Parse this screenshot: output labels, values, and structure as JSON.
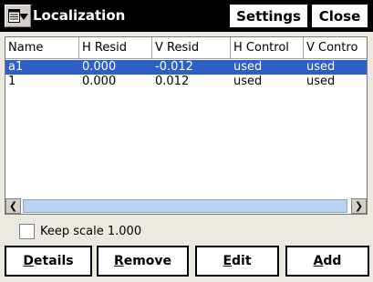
{
  "titlebar": {
    "title": "Localization",
    "settings_label": "Settings",
    "close_label": "Close",
    "menu_icon": "menu-icon"
  },
  "table": {
    "columns": [
      "Name",
      "H Resid",
      "V Resid",
      "H Control",
      "V Contro"
    ],
    "rows": [
      {
        "name": "a1",
        "h_resid": "0.000",
        "v_resid": "-0.012",
        "h_control": "used",
        "v_control": "used",
        "selected": true
      },
      {
        "name": "1",
        "h_resid": "0.000",
        "v_resid": "0.012",
        "h_control": "used",
        "v_control": "used",
        "selected": false
      }
    ]
  },
  "keep_scale": {
    "label": "Keep scale 1.000",
    "checked": false
  },
  "buttons": {
    "details": {
      "underline": "D",
      "rest": "etails"
    },
    "remove": {
      "underline": "R",
      "rest": "emove"
    },
    "edit": {
      "underline": "E",
      "rest": "dit"
    },
    "add": {
      "underline": "A",
      "rest": "dd"
    }
  },
  "colors": {
    "selection": "#2d5fc4",
    "titlebar": "#000000"
  }
}
